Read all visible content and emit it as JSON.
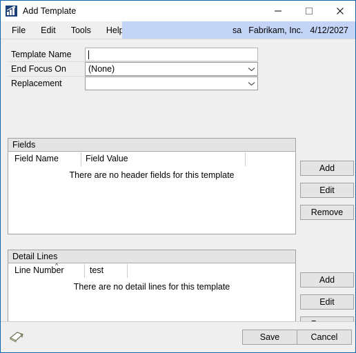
{
  "window": {
    "title": "Add Template",
    "app_icon": "bar-chart-icon",
    "controls": {
      "minimize": "minimize-icon",
      "maximize": "maximize-icon",
      "close": "close-icon"
    }
  },
  "menubar": {
    "items": [
      {
        "label": "File"
      },
      {
        "label": "Edit"
      },
      {
        "label": "Tools"
      },
      {
        "label": "Help"
      }
    ],
    "status": {
      "user": "sa",
      "company": "Fabrikam, Inc.",
      "date": "4/12/2027",
      "background": "#C3D4F7"
    }
  },
  "form": {
    "rows": [
      {
        "label": "Template Name",
        "type": "text",
        "value": "",
        "placeholder": ""
      },
      {
        "label": "End Focus On",
        "type": "combo",
        "value": "(None)"
      },
      {
        "label": "Replacement",
        "type": "combo",
        "value": ""
      }
    ]
  },
  "fields_section": {
    "title": "Fields",
    "columns": [
      {
        "label": "Field Name"
      },
      {
        "label": "Field Value"
      }
    ],
    "empty_message": "There are no header fields for this template",
    "rows": [],
    "buttons": [
      {
        "label": "Add"
      },
      {
        "label": "Edit"
      },
      {
        "label": "Remove"
      }
    ]
  },
  "detail_section": {
    "title": "Detail Lines",
    "columns": [
      {
        "label": "Line Number",
        "sort": "ascending"
      },
      {
        "label": "test"
      }
    ],
    "empty_message": "There are no detail lines for this template",
    "rows": [],
    "buttons": [
      {
        "label": "Add"
      },
      {
        "label": "Edit"
      },
      {
        "label": "Remove"
      }
    ]
  },
  "footer": {
    "note_icon": "note-icon",
    "save_label": "Save",
    "cancel_label": "Cancel"
  }
}
